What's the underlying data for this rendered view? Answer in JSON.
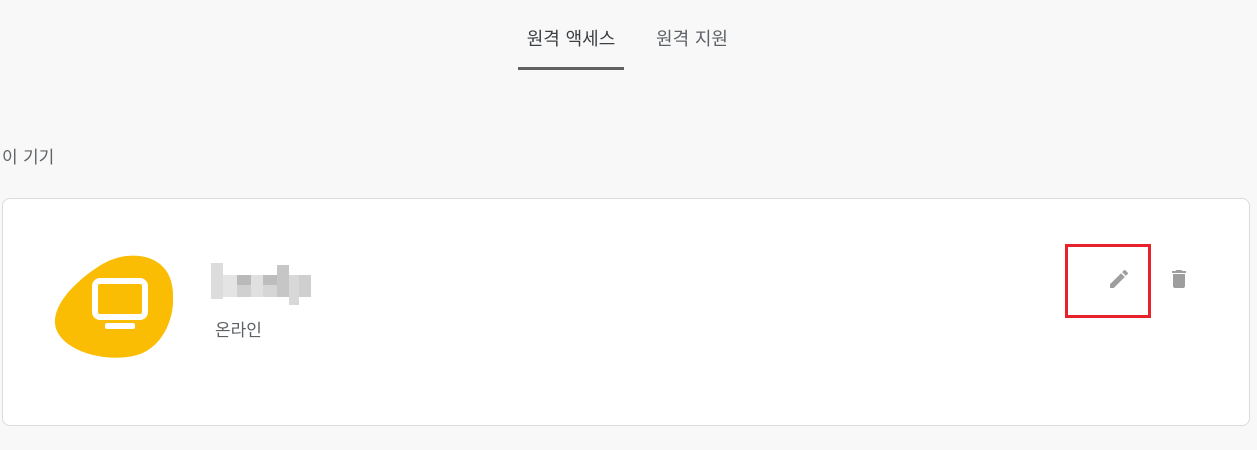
{
  "tabs": [
    {
      "label": "원격 액세스",
      "active": true
    },
    {
      "label": "원격 지원",
      "active": false
    }
  ],
  "section": {
    "heading": "이 기기"
  },
  "device": {
    "name": "",
    "name_redacted": true,
    "status": "온라인",
    "icon": "monitor-icon",
    "blob_color": "#fbbc04"
  },
  "actions": {
    "edit_icon": "pencil-icon",
    "delete_icon": "trash-icon",
    "highlight_color": "#e8222a"
  },
  "colors": {
    "background": "#f8f8f8",
    "card": "#ffffff",
    "tab_underline": "#616161",
    "icon_gray": "#9e9e9e"
  }
}
